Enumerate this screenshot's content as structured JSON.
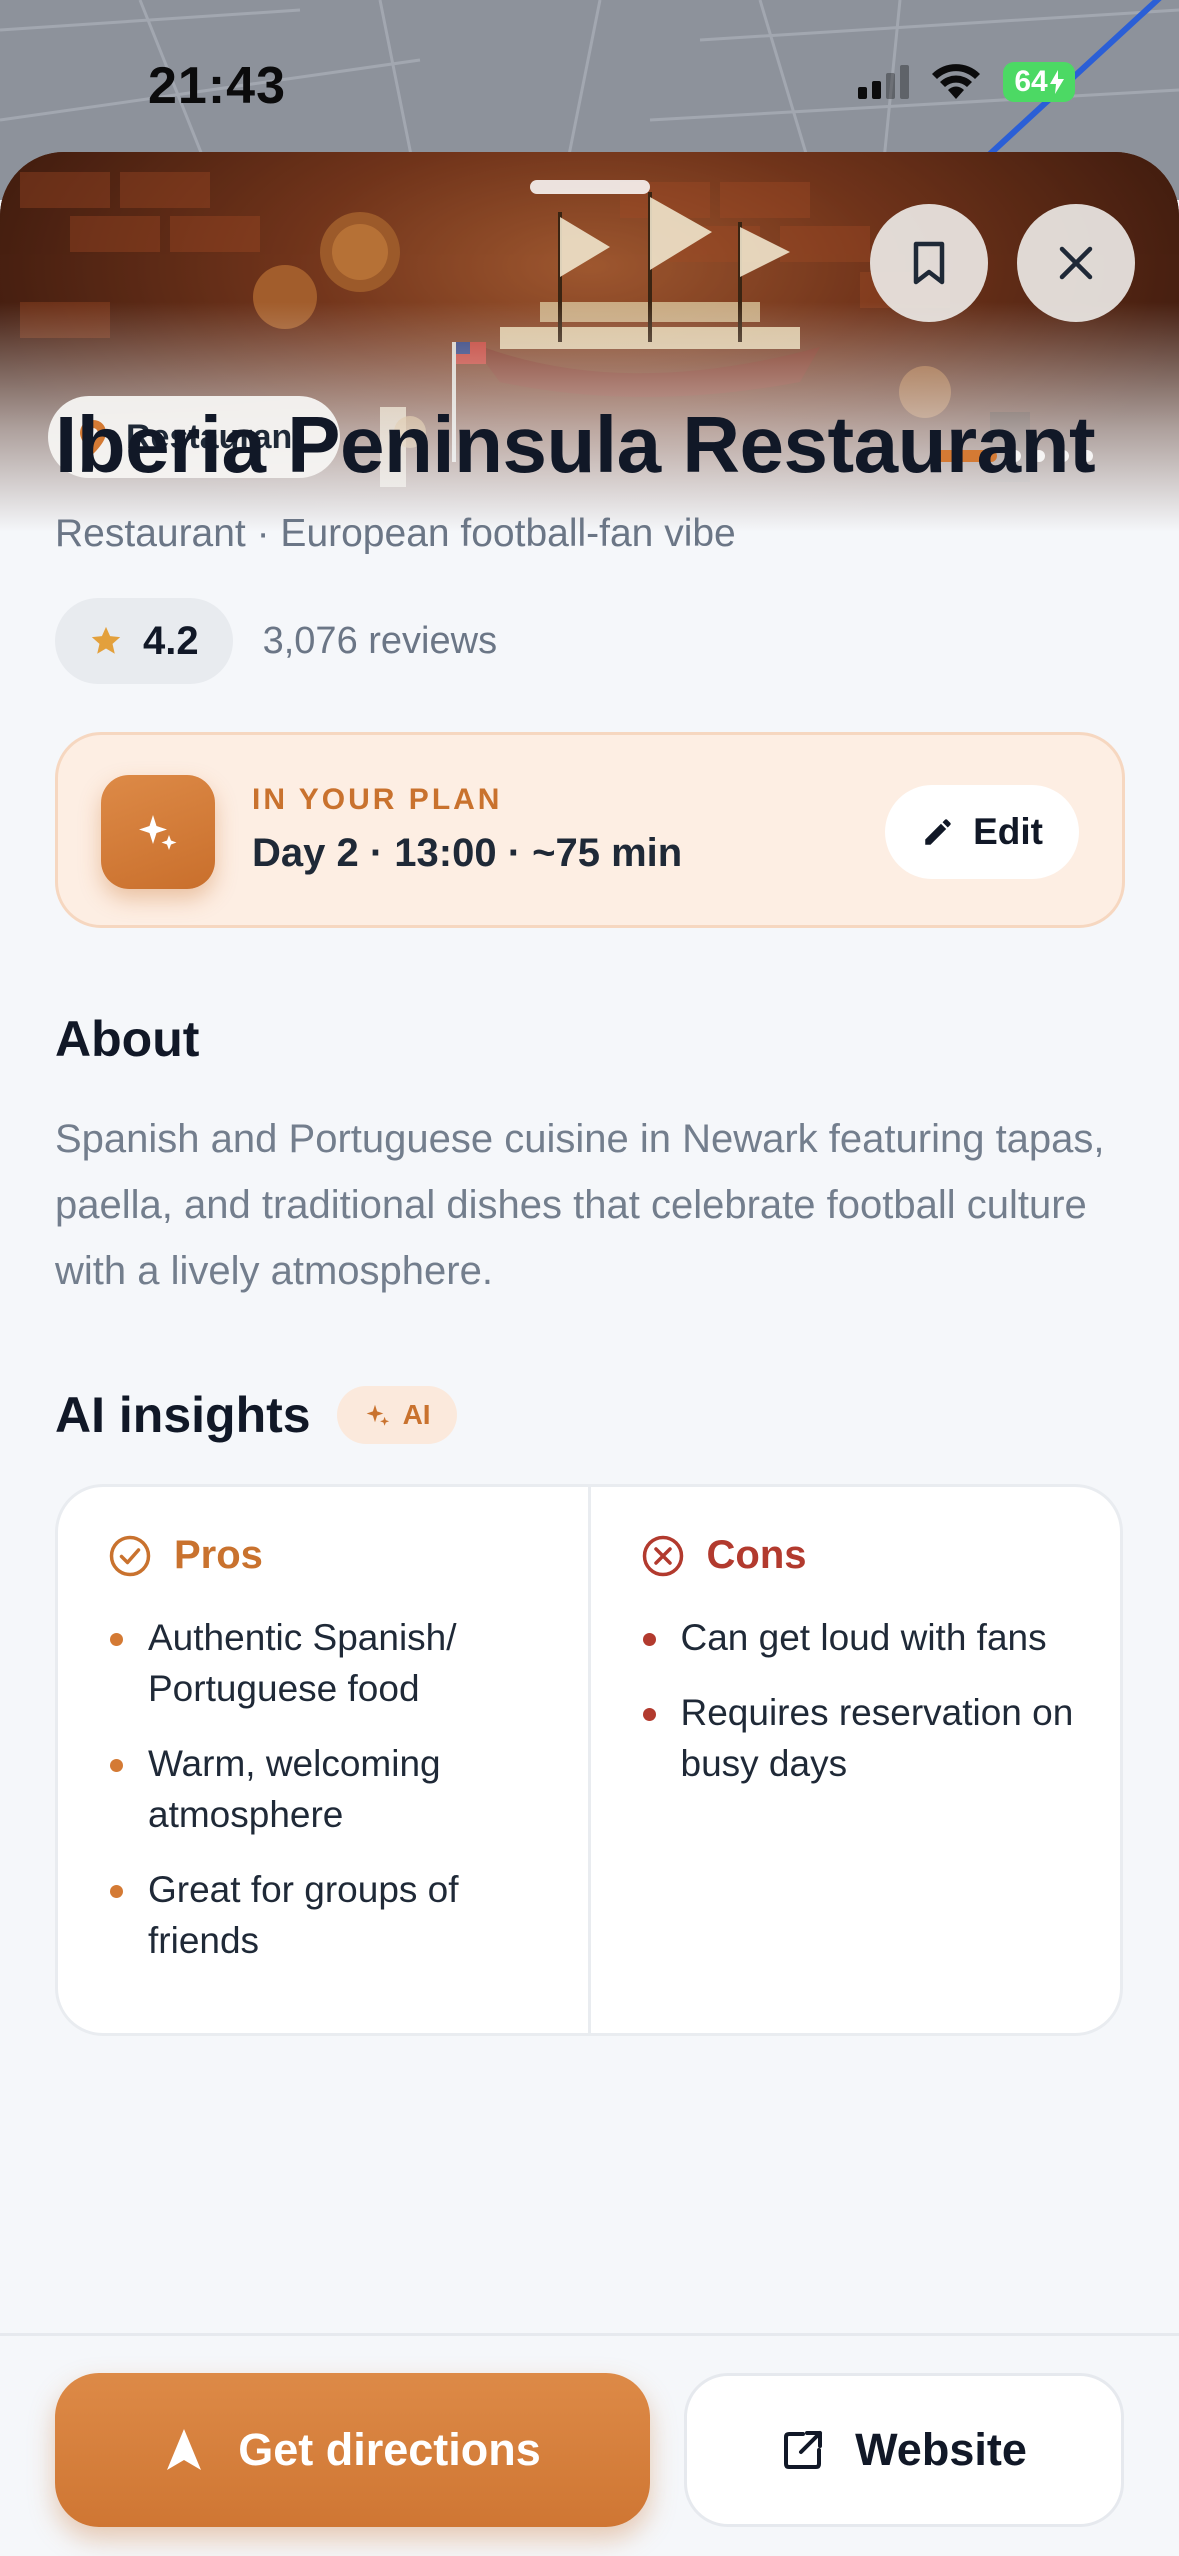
{
  "status_bar": {
    "time": "21:43",
    "battery": "64"
  },
  "place": {
    "category_chip": "Restaurant",
    "name": "Iberia Peninsula Restaurant",
    "subtitle": "Restaurant · European football-fan vibe",
    "rating": "4.2",
    "reviews": "3,076 reviews",
    "photo_count": 5,
    "active_photo_index": 0
  },
  "plan": {
    "kicker": "IN YOUR PLAN",
    "detail": "Day 2 · 13:00 · ~75 min",
    "edit_label": "Edit"
  },
  "about": {
    "title": "About",
    "text": "Spanish and Portuguese cuisine in Newark featuring tapas, paella, and traditional dishes that celebrate football culture with a lively atmosphere."
  },
  "insights": {
    "title": "AI insights",
    "badge": "AI",
    "pros_title": "Pros",
    "pros": [
      "Authentic Spanish/ Portuguese food",
      "Warm, welcoming atmosphere",
      "Great for groups of friends"
    ],
    "cons_title": "Cons",
    "cons": [
      "Can get loud with fans",
      "Requires reservation on busy days"
    ]
  },
  "actions": {
    "directions_label": "Get directions",
    "website_label": "Website"
  },
  "colors": {
    "accent": "#d47a34",
    "cons": "#b23a2e",
    "plan_bg": "#fdeee3"
  },
  "icons": [
    "location-pin-icon",
    "bookmark-icon",
    "close-icon",
    "star-icon",
    "sparkles-icon",
    "pencil-icon",
    "check-circle-icon",
    "x-circle-icon",
    "navigation-arrow-icon",
    "external-link-icon"
  ]
}
